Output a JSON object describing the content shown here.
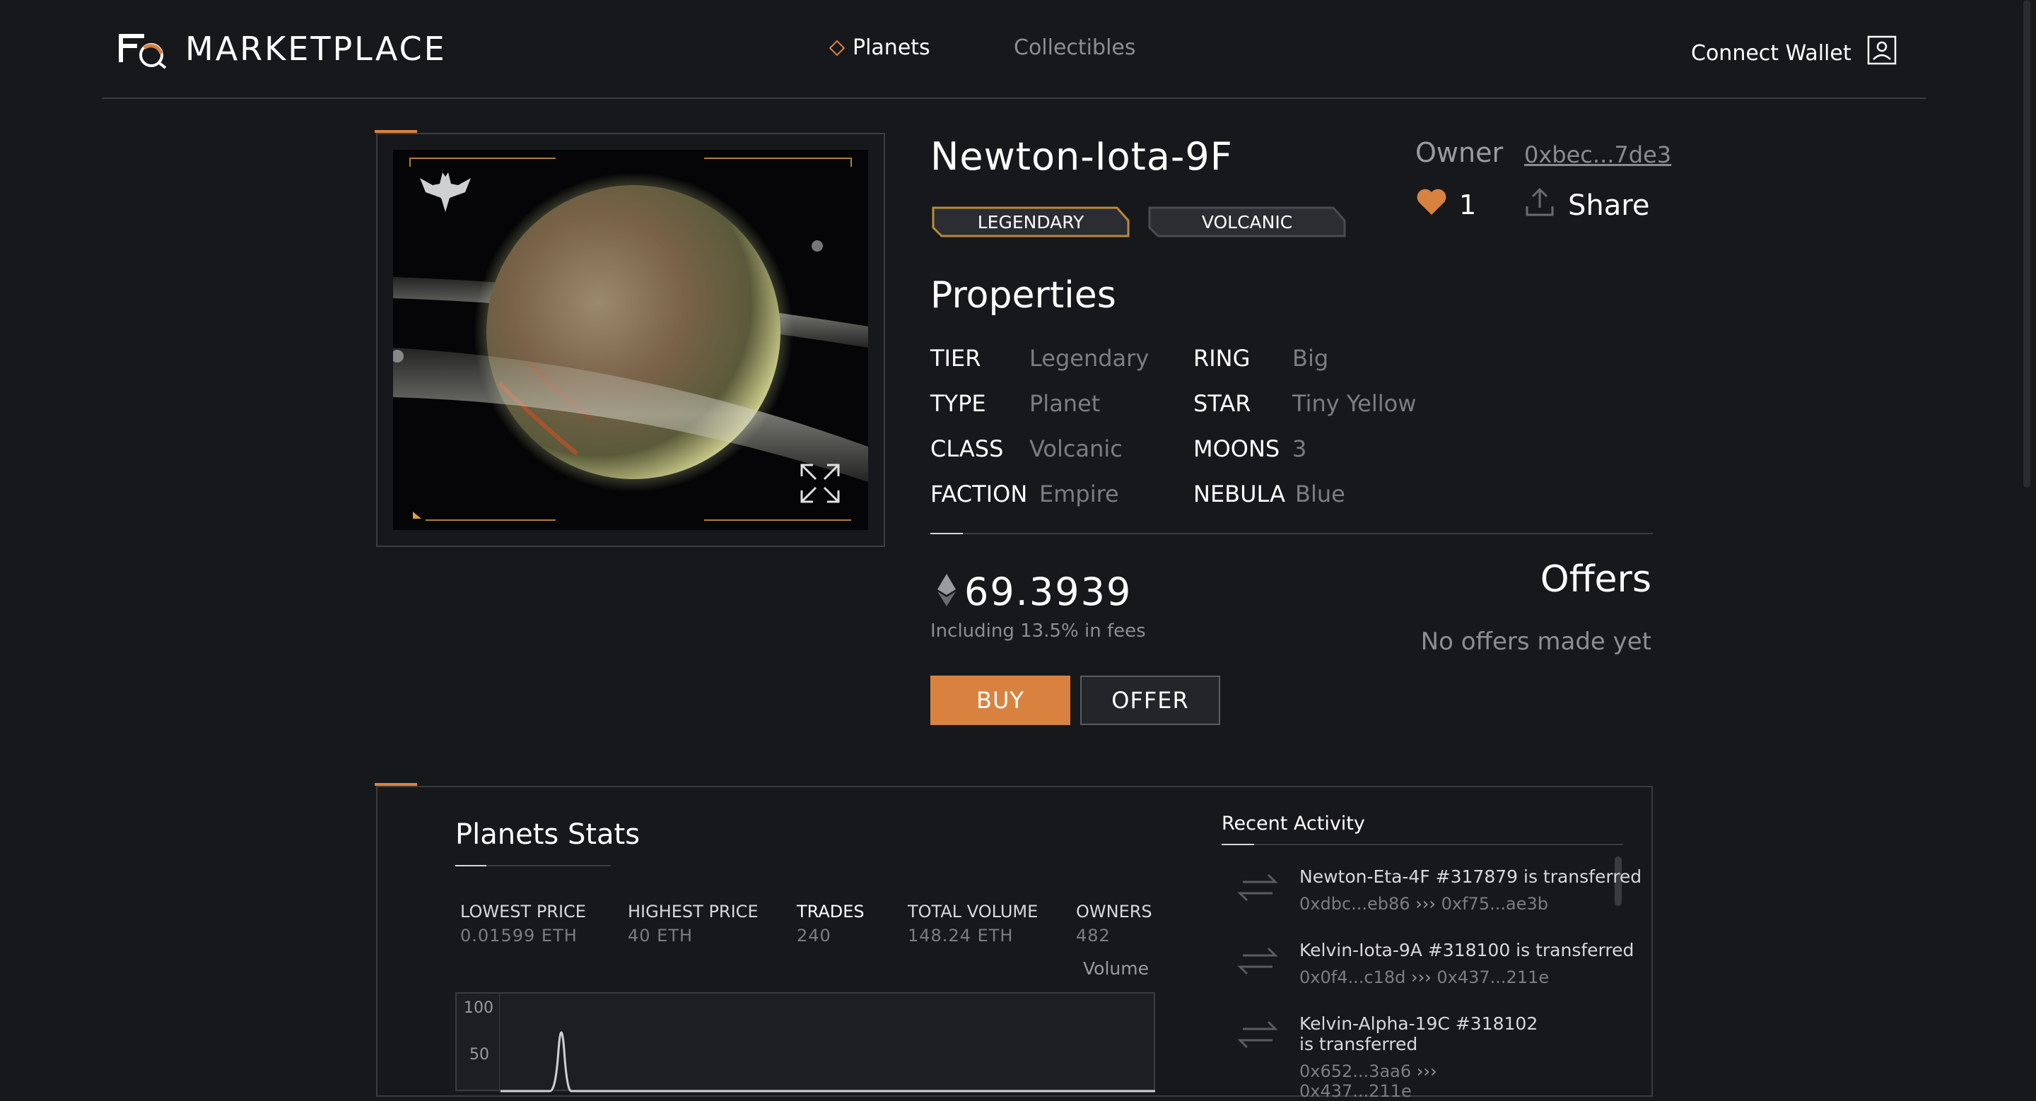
{
  "header": {
    "brand": "MARKETPLACE",
    "nav": [
      {
        "label": "Planets",
        "active": true
      },
      {
        "label": "Collectibles",
        "active": false
      }
    ],
    "connect_label": "Connect Wallet"
  },
  "item": {
    "title": "Newton-Iota-9F",
    "tags": [
      "LEGENDARY",
      "VOLCANIC"
    ],
    "owner_label": "Owner",
    "owner_address": "0xbec...7de3",
    "likes": "1",
    "share_label": "Share"
  },
  "properties": {
    "title": "Properties",
    "left": [
      {
        "key": "TIER",
        "value": "Legendary"
      },
      {
        "key": "TYPE",
        "value": "Planet"
      },
      {
        "key": "CLASS",
        "value": "Volcanic"
      },
      {
        "key": "FACTION",
        "value": "Empire"
      }
    ],
    "right": [
      {
        "key": "RING",
        "value": "Big"
      },
      {
        "key": "STAR",
        "value": "Tiny Yellow"
      },
      {
        "key": "MOONS",
        "value": "3"
      },
      {
        "key": "NEBULA",
        "value": "Blue"
      }
    ]
  },
  "price": {
    "value": "69.3939",
    "fees_note": "Including 13.5% in fees",
    "buy_label": "BUY",
    "offer_label": "OFFER"
  },
  "offers": {
    "title": "Offers",
    "empty_text": "No offers made yet"
  },
  "stats": {
    "title": "Planets Stats",
    "items": [
      {
        "key": "LOWEST PRICE",
        "value": "0.01599 ETH"
      },
      {
        "key": "HIGHEST PRICE",
        "value": "40 ETH"
      },
      {
        "key": "TRADES",
        "value": "240"
      },
      {
        "key": "TOTAL VOLUME",
        "value": "148.24 ETH"
      },
      {
        "key": "OWNERS",
        "value": "482"
      }
    ],
    "volume_label": "Volume",
    "chart_ticks": [
      "100",
      "50"
    ]
  },
  "activity": {
    "title": "Recent Activity",
    "items": [
      {
        "text": "Newton-Eta-4F #317879 is transferred",
        "from": "0xdbc...eb86",
        "to": "0xf75...ae3b"
      },
      {
        "text": "Kelvin-Iota-9A #318100 is transferred",
        "from": "0x0f4...c18d",
        "to": "0x437...211e"
      },
      {
        "text": "Kelvin-Alpha-19C #318102 is transferred",
        "from": "0x652...3aa6",
        "to": "0x437...211e"
      }
    ]
  },
  "colors": {
    "accent": "#d9823f",
    "background": "#17181b"
  }
}
